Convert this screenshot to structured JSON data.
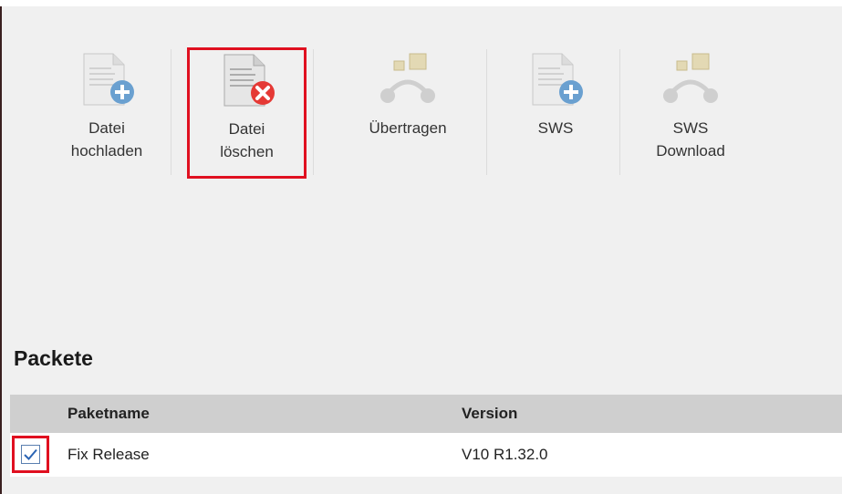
{
  "toolbar": {
    "buttons": [
      {
        "label": "Datei\nhochladen",
        "icon": "file-add-icon"
      },
      {
        "label": "Datei\nlöschen",
        "icon": "file-delete-icon"
      },
      {
        "label": "Übertragen",
        "icon": "transfer-icon"
      },
      {
        "label": "SWS",
        "icon": "file-add-icon"
      },
      {
        "label": "SWS\nDownload",
        "icon": "transfer-icon"
      }
    ]
  },
  "packages": {
    "title": "Packete",
    "columns": [
      "Paketname",
      "Version"
    ],
    "rows": [
      {
        "checked": true,
        "name": "Fix Release",
        "version": "V10 R1.32.0"
      }
    ]
  },
  "colors": {
    "highlight": "#e01020",
    "header_bg": "#cfcfcf",
    "add_badge": "#6aa0d0",
    "delete_badge": "#e53935",
    "checkmark": "#2a64b4"
  }
}
